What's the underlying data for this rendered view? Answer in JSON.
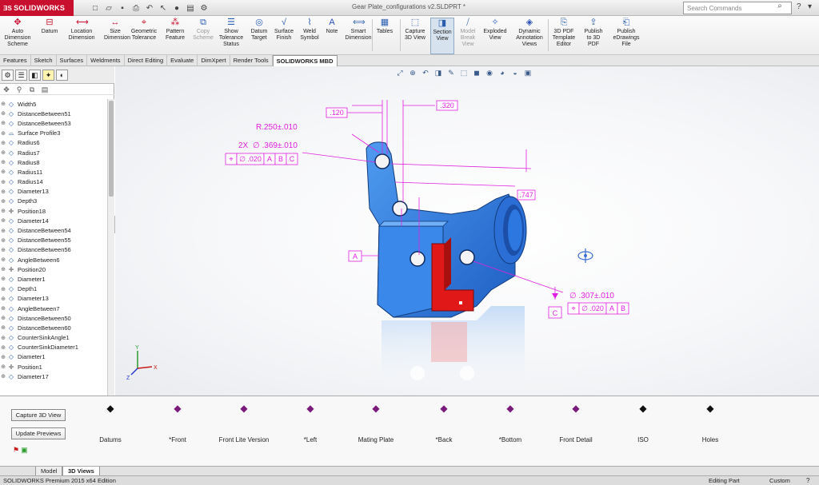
{
  "app": {
    "logo_text": "SOLIDWORKS",
    "document_title": "Gear Plate_configurations v2.SLDPRT *",
    "search_placeholder": "Search Commands",
    "quick_access": [
      "new-icon",
      "open-icon",
      "save-icon",
      "print-icon",
      "undo-icon",
      "select-icon",
      "rebuild-icon",
      "file-properties-icon",
      "options-icon"
    ]
  },
  "ribbon": {
    "buttons": [
      {
        "label": "Auto\nDimension\nScheme",
        "icon": "auto-dimension-icon"
      },
      {
        "label": "Datum",
        "icon": "datum-icon"
      },
      {
        "label": "Location\nDimension",
        "icon": "location-dimension-icon"
      },
      {
        "label": "Size\nDimension",
        "icon": "size-dimension-icon"
      },
      {
        "label": "Geometric\nTolerance",
        "icon": "geometric-tolerance-icon"
      },
      {
        "label": "Pattern\nFeature",
        "icon": "pattern-feature-icon"
      },
      {
        "label": "Copy\nScheme",
        "icon": "copy-scheme-icon"
      },
      {
        "label": "Show\nTolerance\nStatus",
        "icon": "show-tolerance-icon"
      },
      {
        "label": "Datum\nTarget",
        "icon": "datum-target-icon"
      },
      {
        "label": "Surface\nFinish",
        "icon": "surface-finish-icon"
      },
      {
        "label": "Weld\nSymbol",
        "icon": "weld-symbol-icon"
      },
      {
        "label": "Note",
        "icon": "note-icon"
      },
      {
        "label": "Smart\nDimension",
        "icon": "smart-dimension-icon"
      },
      {
        "label": "Tables",
        "icon": "tables-icon"
      },
      {
        "label": "Capture\n3D View",
        "icon": "capture-3d-view-icon"
      },
      {
        "label": "Section\nView",
        "icon": "section-view-icon"
      },
      {
        "label": "Model\nBreak\nView",
        "icon": "model-break-view-icon"
      },
      {
        "label": "Exploded\nView",
        "icon": "exploded-view-icon"
      },
      {
        "label": "Dynamic\nAnnotation\nViews",
        "icon": "dynamic-annotation-icon"
      },
      {
        "label": "3D PDF\nTemplate\nEditor",
        "icon": "pdf-template-icon"
      },
      {
        "label": "Publish\nto 3D\nPDF",
        "icon": "publish-pdf-icon"
      },
      {
        "label": "Publish\neDrawings\nFile",
        "icon": "publish-edrawings-icon"
      }
    ]
  },
  "command_tabs": [
    "Features",
    "Sketch",
    "Surfaces",
    "Weldments",
    "Direct Editing",
    "Evaluate",
    "DimXpert",
    "Render Tools",
    "SOLIDWORKS MBD"
  ],
  "active_command_tab": "SOLIDWORKS MBD",
  "feature_tree": {
    "items": [
      {
        "label": "Width5",
        "icon": "dimension-icon"
      },
      {
        "label": "DistanceBetween51",
        "icon": "dimension-icon"
      },
      {
        "label": "DistanceBetween53",
        "icon": "dimension-icon"
      },
      {
        "label": "Surface Profile3",
        "icon": "surface-profile-icon"
      },
      {
        "label": "Radius6",
        "icon": "dimension-icon"
      },
      {
        "label": "Radius7",
        "icon": "dimension-icon"
      },
      {
        "label": "Radius8",
        "icon": "dimension-icon"
      },
      {
        "label": "Radius11",
        "icon": "dimension-icon"
      },
      {
        "label": "Radius14",
        "icon": "dimension-icon"
      },
      {
        "label": "Diameter13",
        "icon": "dimension-icon"
      },
      {
        "label": "Depth3",
        "icon": "dimension-icon"
      },
      {
        "label": "Position18",
        "icon": "position-icon"
      },
      {
        "label": "Diameter14",
        "icon": "dimension-icon"
      },
      {
        "label": "DistanceBetween54",
        "icon": "dimension-icon"
      },
      {
        "label": "DistanceBetween55",
        "icon": "dimension-icon"
      },
      {
        "label": "DistanceBetween56",
        "icon": "dimension-icon"
      },
      {
        "label": "AngleBetween6",
        "icon": "dimension-icon"
      },
      {
        "label": "Position20",
        "icon": "position-icon"
      },
      {
        "label": "Diameter1",
        "icon": "dimension-icon"
      },
      {
        "label": "Depth1",
        "icon": "dimension-icon"
      },
      {
        "label": "Diameter13",
        "icon": "dimension-icon"
      },
      {
        "label": "AngleBetween7",
        "icon": "dimension-icon"
      },
      {
        "label": "DistanceBetween50",
        "icon": "dimension-icon"
      },
      {
        "label": "DistanceBetween60",
        "icon": "dimension-icon"
      },
      {
        "label": "CounterSinkAngle1",
        "icon": "dimension-icon"
      },
      {
        "label": "CounterSinkDiameter1",
        "icon": "dimension-icon"
      },
      {
        "label": "Diameter1",
        "icon": "dimension-icon"
      },
      {
        "label": "Position1",
        "icon": "position-icon"
      },
      {
        "label": "Diameter17",
        "icon": "dimension-icon"
      }
    ]
  },
  "annotations": {
    "dim_120": ".120",
    "dim_320": ".320",
    "radius": "R.250±.010",
    "hole_count": "2X",
    "hole_dia": "∅ .369±.010",
    "fcf_upper": [
      "⌖",
      "∅ .020",
      "A",
      "B",
      "C"
    ],
    "dim_747": ".747",
    "datum_a": "A",
    "datum_c": "C",
    "hole_dia2": "∅ .307±.010",
    "fcf_lower": [
      "⌖",
      "∅ .020",
      "A",
      "B"
    ]
  },
  "views_panel": {
    "capture_button": "Capture 3D View",
    "update_button": "Update Previews",
    "views": [
      "Datums",
      "*Front",
      "Front Lite Version",
      "*Left",
      "Mating Plate",
      "*Back",
      "*Bottom",
      "Front Detail",
      "ISO",
      "Holes"
    ]
  },
  "bottom_tabs": [
    "Model",
    "3D Views"
  ],
  "active_bottom_tab": "3D Views",
  "status": {
    "edition": "SOLIDWORKS Premium 2015 x64 Edition",
    "mode": "Editing Part",
    "units": "Custom"
  },
  "colors": {
    "brand_red": "#c8102e",
    "annotation_magenta": "#e020e0",
    "part_blue": "#2f7fe0",
    "highlight_red": "#e01818"
  }
}
